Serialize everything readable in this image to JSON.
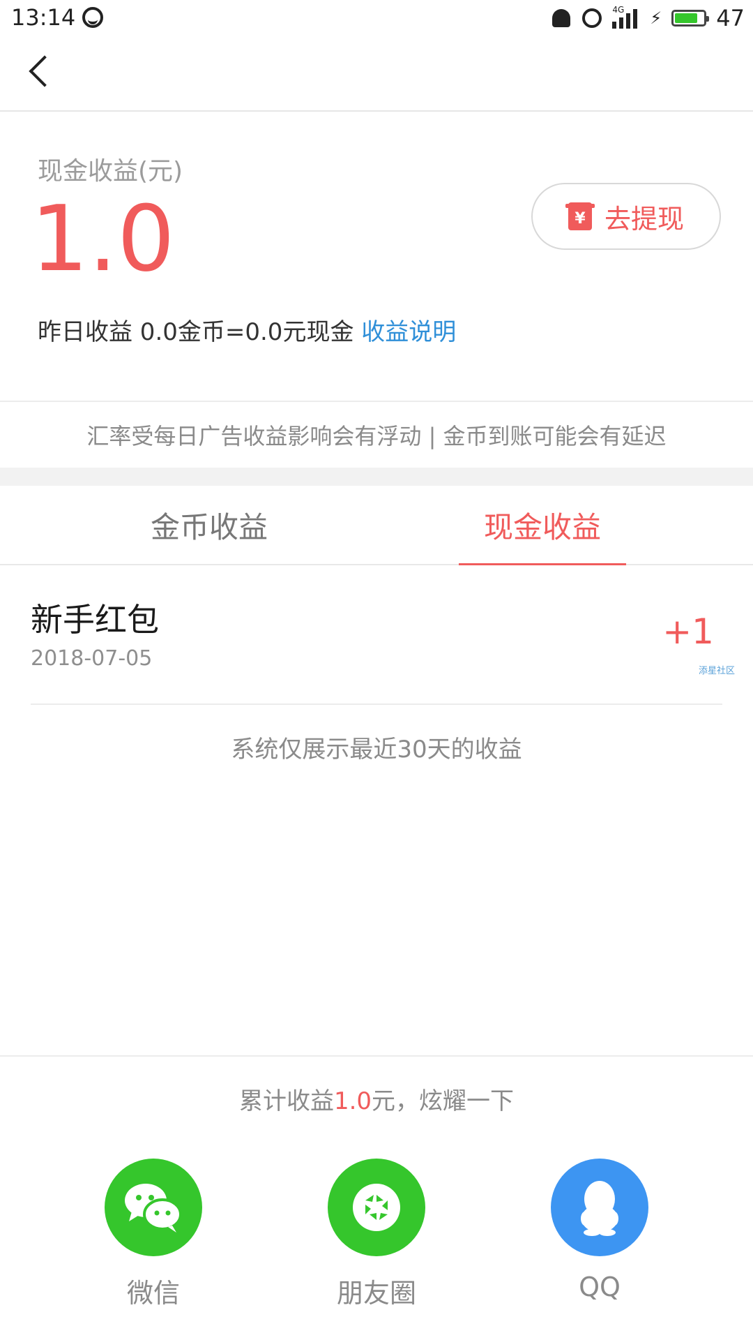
{
  "status_bar": {
    "time": "13:14",
    "network": "4G",
    "battery_level": "47",
    "battery_fill_percent": 80
  },
  "nav": {
    "back_icon": "back-arrow-icon"
  },
  "summary": {
    "label": "现金收益(元)",
    "amount": "1.0",
    "withdraw_label": "去提现",
    "withdraw_icon_glyph": "¥",
    "yesterday_text": "昨日收益 0.0金币=0.0元现金",
    "explain_link": "收益说明"
  },
  "notice": "汇率受每日广告收益影响会有浮动 | 金币到账可能会有延迟",
  "tabs": [
    {
      "label": "金币收益",
      "active": false
    },
    {
      "label": "现金收益",
      "active": true
    }
  ],
  "records": [
    {
      "title": "新手红包",
      "date": "2018-07-05",
      "amount": "+1"
    }
  ],
  "watermark": "添星社区",
  "records_note": "系统仅展示最近30天的收益",
  "share": {
    "caption_prefix": "累计收益",
    "caption_amount": "1.0",
    "caption_suffix": "元，炫耀一下",
    "targets": [
      {
        "label": "微信",
        "icon": "wechat-icon",
        "color": "#35c62c"
      },
      {
        "label": "朋友圈",
        "icon": "moments-icon",
        "color": "#35c62c"
      },
      {
        "label": "QQ",
        "icon": "qq-icon",
        "color": "#3d95f2"
      }
    ]
  },
  "colors": {
    "accent": "#f05b5b",
    "link": "#2f8fd8",
    "wechat_green": "#35c62c",
    "qq_blue": "#3d95f2"
  }
}
